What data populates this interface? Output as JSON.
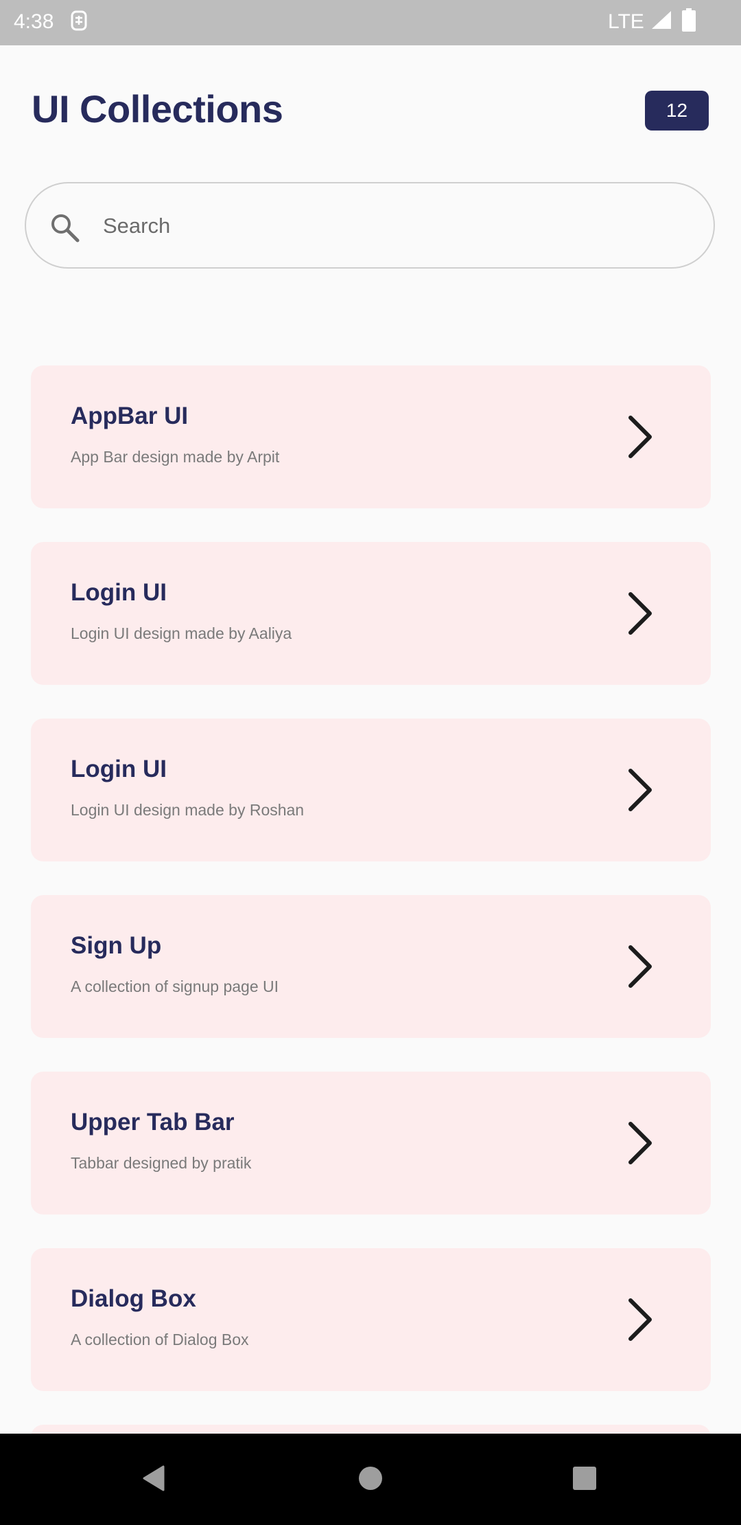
{
  "status_bar": {
    "time": "4:38",
    "network": "LTE",
    "icons": [
      "sim-notification-icon",
      "signal-icon",
      "battery-icon"
    ]
  },
  "header": {
    "title": "UI Collections",
    "count": "12"
  },
  "search": {
    "placeholder": "Search",
    "value": "",
    "icon": "search-icon"
  },
  "collections": [
    {
      "title": "AppBar UI",
      "subtitle": "App Bar design made by Arpit"
    },
    {
      "title": "Login UI",
      "subtitle": "Login UI design made by Aaliya"
    },
    {
      "title": "Login UI",
      "subtitle": "Login UI design made by Roshan"
    },
    {
      "title": "Sign Up",
      "subtitle": "A collection of signup page UI"
    },
    {
      "title": "Upper Tab Bar",
      "subtitle": "Tabbar designed by pratik"
    },
    {
      "title": "Dialog Box",
      "subtitle": "A collection of Dialog Box"
    },
    {
      "title": "",
      "subtitle": ""
    }
  ],
  "nav_bar": {
    "icons": [
      "back-icon",
      "home-icon",
      "recents-icon"
    ]
  },
  "colors": {
    "title": "#272b5c",
    "badge_bg": "#272b5c",
    "card_bg": "#fdeced",
    "subtitle": "#7a7a7a",
    "status_bar_bg": "#bdbdbd",
    "nav_bar_bg": "#000000",
    "page_bg": "#fafafa"
  }
}
